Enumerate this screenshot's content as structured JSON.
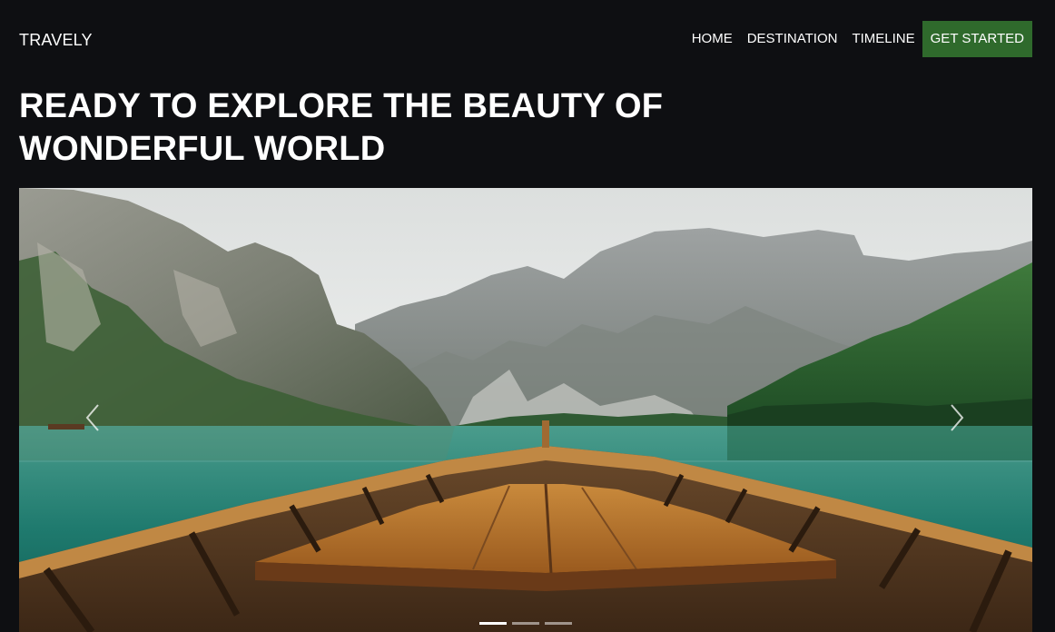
{
  "brand": "TRAVELY",
  "nav": {
    "links": [
      "HOME",
      "DESTINATION",
      "TIMELINE"
    ],
    "cta": "GET STARTED",
    "cta_color": "#2f6a2c"
  },
  "hero": {
    "line1": "READY TO EXPLORE THE BEAUTY OF",
    "line2": "WONDERFUL WORLD"
  },
  "carousel": {
    "image": "mountain-lake-boat-photo",
    "prev_icon": "chevron-left-icon",
    "next_icon": "chevron-right-icon",
    "slide_count": 3,
    "active_slide": 1
  }
}
